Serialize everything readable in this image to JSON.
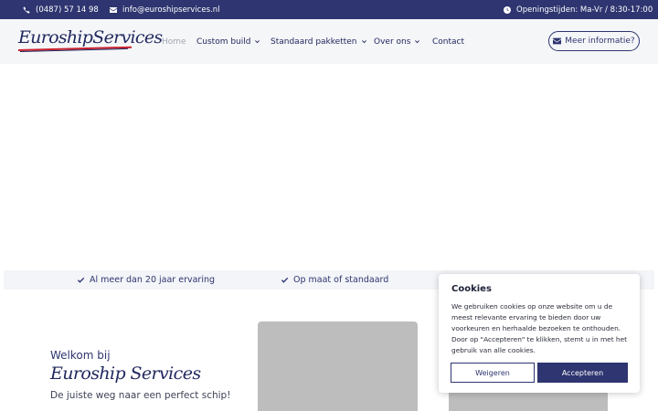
{
  "topbar": {
    "phone": "(0487) 57 14 98",
    "email": "info@euroshipservices.nl",
    "hours": "Openingstijden: Ma-Vr / 8:30-17:00"
  },
  "brand": {
    "logo_text": "EuroshipServices"
  },
  "nav": {
    "items": [
      {
        "label": "Home",
        "active": true
      },
      {
        "label": "Custom build"
      },
      {
        "label": "Standaard pakketten"
      },
      {
        "label": "Over ons"
      },
      {
        "label": "Contact"
      }
    ],
    "cta_label": "Meer informatie?"
  },
  "usps": [
    "Al meer dan 20 jaar ervaring",
    "Op maat of standaard"
  ],
  "welcome": {
    "pre": "Welkom bij",
    "title": "Euroship Services",
    "subtitle": "De juiste weg naar een perfect schip!"
  },
  "cookie": {
    "title": "Cookies",
    "text": "We gebruiken cookies op onze website om u de meest relevante ervaring te bieden door uw voorkeuren en herhaalde bezoeken te onthouden. Door op \"Accepteren\" te klikken, stemt u in met het gebruik van alle cookies.",
    "decline_label": "Weigeren",
    "accept_label": "Accepteren"
  },
  "colors": {
    "primary": "#2e3570",
    "accent": "#c8202d",
    "navbar_bg": "#f5f6f8"
  }
}
